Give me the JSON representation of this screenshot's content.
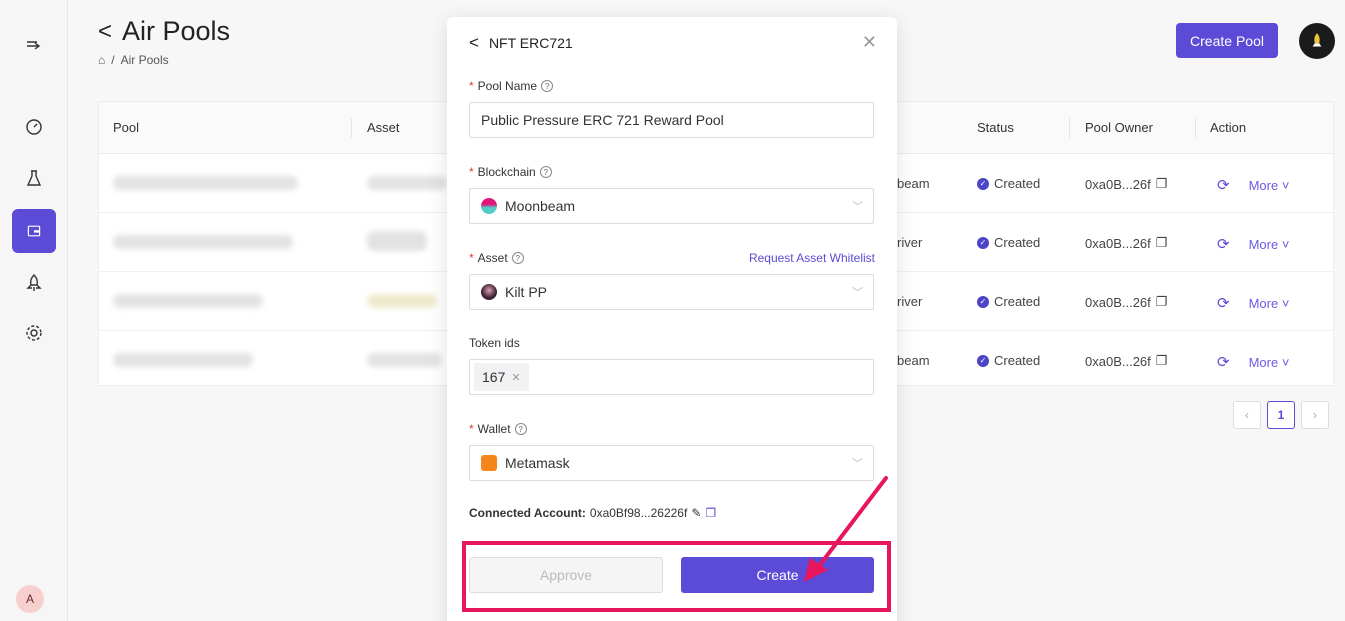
{
  "sidebar": {
    "avatar_initial": "A"
  },
  "header": {
    "title": "Air Pools",
    "breadcrumb_current": "Air Pools",
    "create_pool_label": "Create Pool"
  },
  "table": {
    "columns": [
      "Pool",
      "Asset",
      "Status",
      "Pool Owner",
      "Action"
    ],
    "rows": [
      {
        "chain": "beam",
        "status": "Created",
        "owner": "0xa0B...26f",
        "more": "More"
      },
      {
        "chain": "river",
        "status": "Created",
        "owner": "0xa0B...26f",
        "more": "More"
      },
      {
        "chain": "river",
        "status": "Created",
        "owner": "0xa0B...26f",
        "more": "More"
      },
      {
        "chain": "beam",
        "status": "Created",
        "owner": "0xa0B...26f",
        "more": "More"
      }
    ],
    "page": "1"
  },
  "modal": {
    "title": "NFT ERC721",
    "pool_name_label": "Pool Name",
    "pool_name_value": "Public Pressure ERC 721 Reward Pool",
    "blockchain_label": "Blockchain",
    "blockchain_value": "Moonbeam",
    "asset_label": "Asset",
    "asset_whitelist_link": "Request Asset Whitelist",
    "asset_value": "Kilt PP",
    "token_ids_label": "Token ids",
    "token_ids": [
      "167"
    ],
    "wallet_label": "Wallet",
    "wallet_value": "Metamask",
    "connected_label": "Connected Account:",
    "connected_value": "0xa0Bf98...26226f",
    "approve_label": "Approve",
    "create_label": "Create"
  },
  "colors": {
    "accent": "#5b4bd6",
    "annotation": "#e8175d"
  }
}
